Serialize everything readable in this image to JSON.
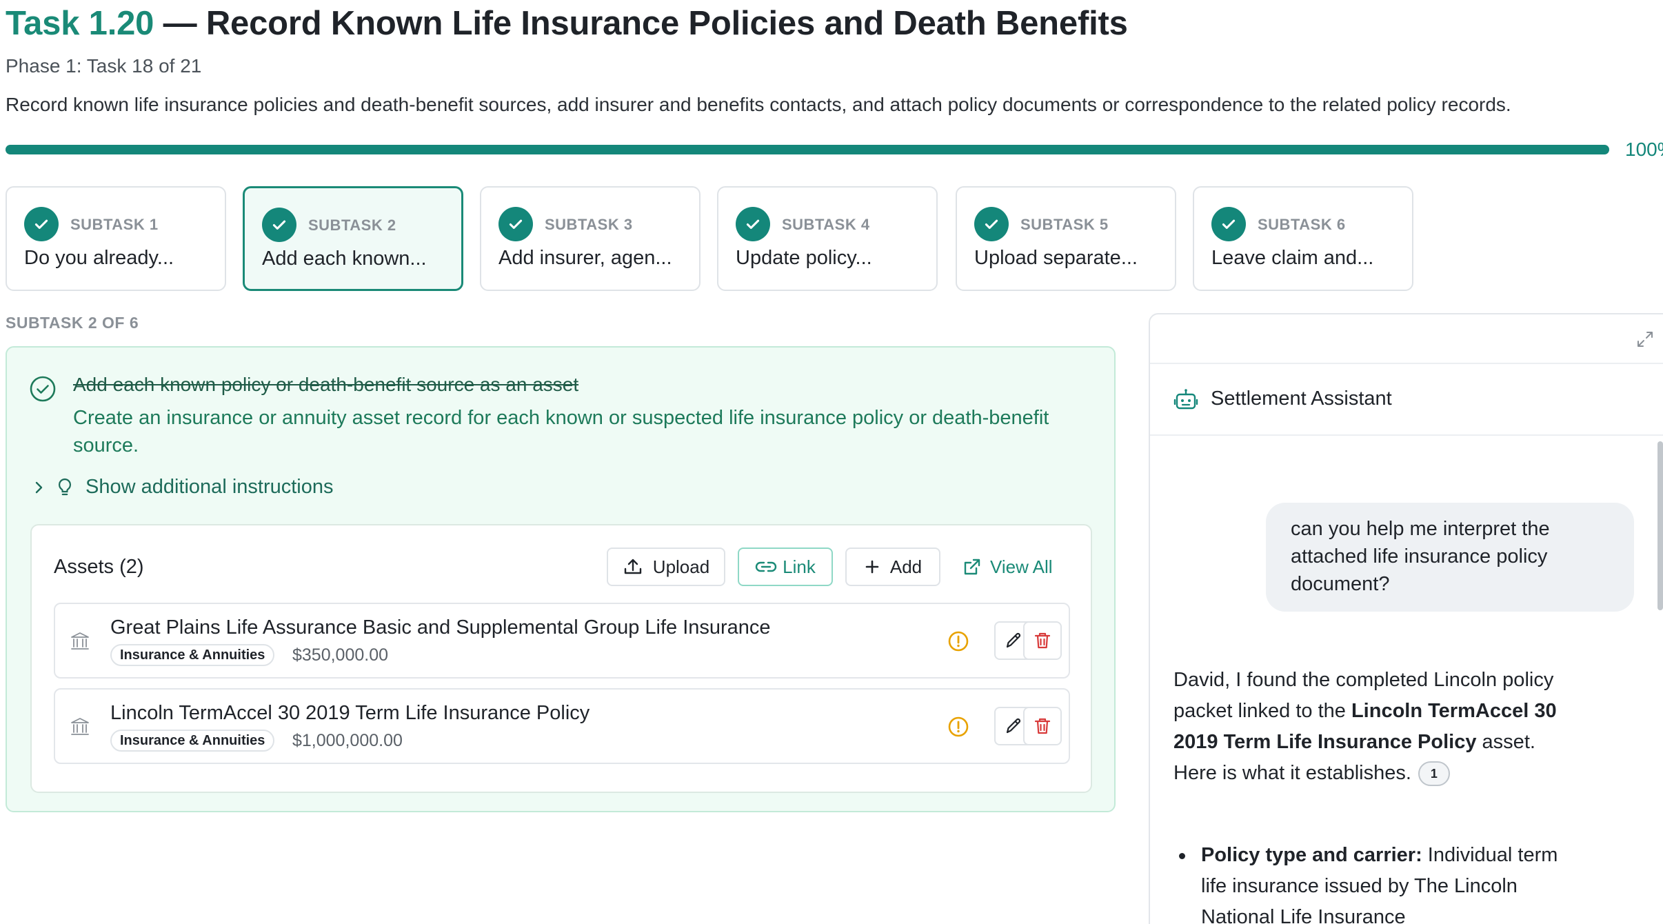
{
  "header": {
    "task_number": "Task 1.20",
    "task_title": " — Record Known Life Insurance Policies and Death Benefits",
    "phase": "Phase 1: Task 18 of 21",
    "description": "Record known life insurance policies and death-benefit sources, add insurer and benefits contacts, and attach policy documents or correspondence to the related policy records."
  },
  "progress": {
    "fraction": 1.0,
    "label": "100%"
  },
  "subtasks": [
    {
      "label": "SUBTASK 1",
      "title": "Do you already...",
      "done": true,
      "active": false
    },
    {
      "label": "SUBTASK 2",
      "title": "Add each known...",
      "done": true,
      "active": true
    },
    {
      "label": "SUBTASK 3",
      "title": "Add insurer, agen...",
      "done": true,
      "active": false
    },
    {
      "label": "SUBTASK 4",
      "title": "Update policy...",
      "done": true,
      "active": false
    },
    {
      "label": "SUBTASK 5",
      "title": "Upload separate...",
      "done": true,
      "active": false
    },
    {
      "label": "SUBTASK 6",
      "title": "Leave claim and...",
      "done": true,
      "active": false
    }
  ],
  "subtask_position": "SUBTASK 2 OF 6",
  "current_subtask": {
    "title": "Add each known policy or death-benefit source as an asset",
    "instructions": "Create an insurance or annuity asset record for each known or suspected life insurance policy or death-benefit source.",
    "show_more_label": "Show additional instructions"
  },
  "assets": {
    "title": "Assets (2)",
    "buttons": {
      "upload": "Upload",
      "link": "Link",
      "add": "Add",
      "view_all": "View All"
    },
    "items": [
      {
        "name": "Great Plains Life Assurance Basic and Supplemental Group Life Insurance",
        "category": "Insurance & Annuities",
        "amount": "$350,000.00"
      },
      {
        "name": "Lincoln TermAccel 30 2019 Term Life Insurance Policy",
        "category": "Insurance & Annuities",
        "amount": "$1,000,000.00"
      }
    ]
  },
  "assistant": {
    "title": "Settlement Assistant",
    "user_message": "can you help me interpret the attached life insurance policy document?",
    "reply_pre": "David, I found the completed Lincoln policy packet linked to the ",
    "reply_bold": "Lincoln TermAccel 30 2019 Term Life Insurance Policy",
    "reply_post": " asset. Here is what it establishes.",
    "citation": "1",
    "bullet_label": "Policy type and carrier:",
    "bullet_text": " Individual term life insurance issued by The Lincoln National Life Insurance"
  },
  "colors": {
    "accent": "#14877a",
    "card_bg": "#effbf5",
    "danger": "#d83a3a",
    "warning": "#e8a200"
  }
}
